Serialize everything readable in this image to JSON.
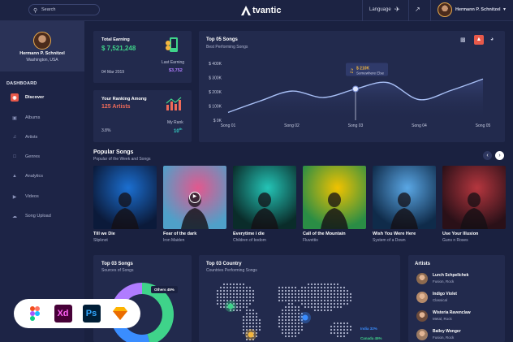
{
  "header": {
    "search_placeholder": "Search",
    "logo_text": "tvantic",
    "language_label": "Language",
    "user_name": "Hermann P. Schnitzel"
  },
  "sidebar": {
    "profile_name": "Hermann P. Schnitzel",
    "profile_location": "Washington, USA",
    "section_label": "DASHBOARD",
    "items": [
      {
        "label": "Discover",
        "icon": "discover-icon",
        "active": true
      },
      {
        "label": "Albums",
        "icon": "album-icon",
        "active": false
      },
      {
        "label": "Artists",
        "icon": "mic-icon",
        "active": false
      },
      {
        "label": "Genres",
        "icon": "genre-icon",
        "active": false
      },
      {
        "label": "Analytics",
        "icon": "analytics-icon",
        "active": false
      },
      {
        "label": "Videos",
        "icon": "video-icon",
        "active": false
      },
      {
        "label": "Song Upload",
        "icon": "upload-icon",
        "active": false
      }
    ]
  },
  "earning": {
    "title": "Total Earning",
    "amount": "$ 7,521,248",
    "date": "04 Mar 2019",
    "last_label": "Last Earning",
    "last_amount": "$3,752"
  },
  "ranking": {
    "title": "Your Ranking Among",
    "value": "125 Artists",
    "percent": "3.8%",
    "my_rank_label": "My Rank",
    "my_rank_value": "10",
    "my_rank_suffix": "th"
  },
  "chart_data": {
    "type": "line",
    "title": "Top 05 Songs",
    "subtitle": "Best Performing Songs",
    "categories": [
      "Song 01",
      "Song 02",
      "Song 03",
      "Song 04",
      "Song 05"
    ],
    "y_ticks": [
      "$ 0K",
      "$ 100K",
      "$ 200K",
      "$ 300K",
      "$ 400K"
    ],
    "ylim": [
      0,
      400
    ],
    "x_points": [
      0,
      0.5,
      1,
      1.5,
      2,
      2.5,
      3,
      3.5,
      4
    ],
    "values": [
      55,
      135,
      205,
      160,
      220,
      265,
      145,
      210,
      290
    ],
    "tooltip": {
      "value": "$ 210K",
      "label": "Somewhere Else",
      "x_index": 4
    },
    "accent": "#a8bff5"
  },
  "popular": {
    "title": "Popular Songs",
    "subtitle": "Popular of the Week and Songs",
    "songs": [
      {
        "title": "Till we Die",
        "artist": "Slipknot",
        "bg1": "#1b6fd1",
        "bg2": "#0b1a3a"
      },
      {
        "title": "Fear of the dark",
        "artist": "Iron Maiden",
        "bg1": "#e2588e",
        "bg2": "#4fa0c9"
      },
      {
        "title": "Everytime i die",
        "artist": "Children of bodom",
        "bg1": "#24c4b6",
        "bg2": "#0a2c2a"
      },
      {
        "title": "Call of the Mountain",
        "artist": "Fluvettio",
        "bg1": "#f1c200",
        "bg2": "#2a8d45"
      },
      {
        "title": "Wish You Were Here",
        "artist": "System of a Down",
        "bg1": "#5aa7e5",
        "bg2": "#0f2b4a"
      },
      {
        "title": "Use Your Illusion",
        "artist": "Guns n Roses",
        "bg1": "#b5363e",
        "bg2": "#2a1018"
      }
    ]
  },
  "top_songs_card": {
    "title": "Top 03 Songs",
    "subtitle": "Sources of Songs",
    "donut_label": "Others 45%"
  },
  "top_country": {
    "title": "Top 03 Country",
    "subtitle": "Countries Performing Songs",
    "legend": [
      {
        "label": "India 32%",
        "color": "#3a8dff"
      },
      {
        "label": "Canada 45%",
        "color": "#3fd38a"
      }
    ]
  },
  "artists": {
    "title": "Artists",
    "items": [
      {
        "name": "Lurch Schpellchek",
        "genre": "Fusion, Rock",
        "color": "#8d6a4f"
      },
      {
        "name": "Indigo Violet",
        "genre": "Classical",
        "color": "#b58a6a"
      },
      {
        "name": "Wisteria Ravenclaw",
        "genre": "Metal, Rock",
        "color": "#6d4c3c"
      },
      {
        "name": "Bailey Wonger",
        "genre": "Fusion, Rock",
        "color": "#9b7a62"
      }
    ]
  },
  "tools": [
    {
      "name": "figma-icon",
      "label": ""
    },
    {
      "name": "xd-icon",
      "label": "Xd"
    },
    {
      "name": "photoshop-icon",
      "label": "Ps"
    },
    {
      "name": "sketch-icon",
      "label": ""
    }
  ]
}
